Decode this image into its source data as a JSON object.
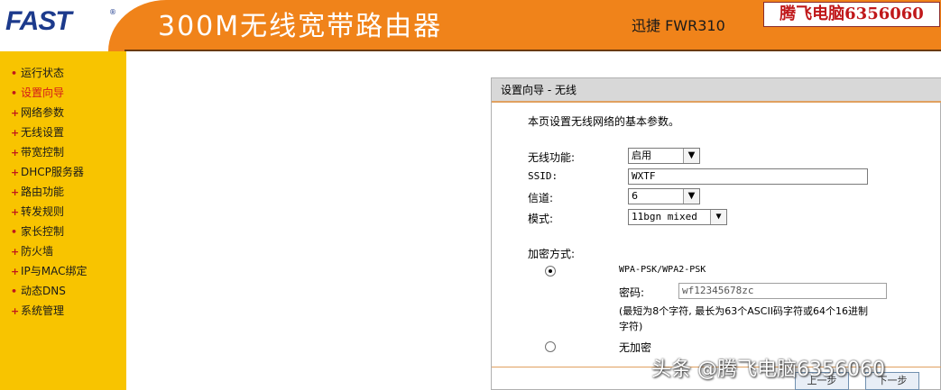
{
  "header": {
    "logo": "FAST",
    "logo_reg": "®",
    "title": "300M无线宽带路由器",
    "model": "迅捷 FWR310",
    "ad_text": "腾飞电脑6356060"
  },
  "sidebar": {
    "items": [
      {
        "label": "运行状态",
        "bullet": "•"
      },
      {
        "label": "设置向导",
        "bullet": "•",
        "active": true
      },
      {
        "label": "网络参数",
        "bullet": "+"
      },
      {
        "label": "无线设置",
        "bullet": "+"
      },
      {
        "label": "带宽控制",
        "bullet": "+"
      },
      {
        "label": "DHCP服务器",
        "bullet": "+"
      },
      {
        "label": "路由功能",
        "bullet": "+"
      },
      {
        "label": "转发规则",
        "bullet": "+"
      },
      {
        "label": "家长控制",
        "bullet": "•"
      },
      {
        "label": "防火墙",
        "bullet": "+"
      },
      {
        "label": "IP与MAC绑定",
        "bullet": "+"
      },
      {
        "label": "动态DNS",
        "bullet": "•"
      },
      {
        "label": "系统管理",
        "bullet": "+"
      }
    ]
  },
  "panel": {
    "title": "设置向导 - 无线",
    "intro": "本页设置无线网络的基本参数。",
    "wireless_label": "无线功能:",
    "wireless_value": "启用",
    "ssid_label": "SSID:",
    "ssid_value": "WXTF",
    "channel_label": "信道:",
    "channel_value": "6",
    "mode_label": "模式:",
    "mode_value": "11bgn mixed",
    "encryption_label": "加密方式:",
    "wpa_label": "WPA-PSK/WPA2-PSK",
    "password_label": "密码:",
    "password_value": "wf12345678zc",
    "hint_line1": "(最短为8个字符, 最长为63个ASCII码字符或64个16进制",
    "hint_line2": "字符)",
    "none_label": "无加密",
    "prev_button": "上一步",
    "next_button": "下一步"
  },
  "watermark": "头条 @腾飞电脑6356060",
  "colors": {
    "banner": "#f0831a",
    "sidebar": "#f8c400",
    "active_nav": "#d41a1a",
    "logo": "#1c3a8c"
  }
}
